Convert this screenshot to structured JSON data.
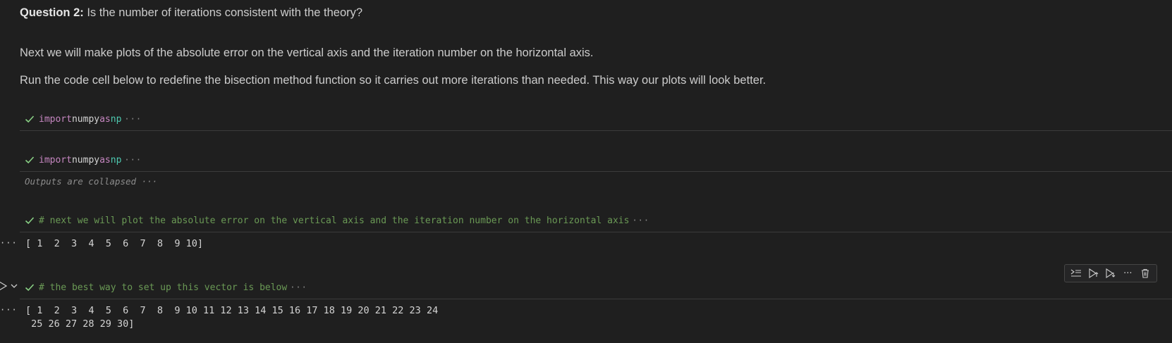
{
  "markdown": {
    "question_bold": "Question 2:",
    "question_text": " Is the number of iterations consistent with the theory?",
    "para1": "Next we will make plots of the absolute error on the vertical axis and the iteration number on the horizontal axis.",
    "para2": "Run the code cell below to redefine the bisection method function so it carries out more iterations than needed. This way our plots will look better."
  },
  "cells": [
    {
      "status": "success",
      "code_keyword": "import",
      "code_module": " numpy ",
      "code_as": "as",
      "code_alias": " np",
      "more": "···"
    },
    {
      "status": "success",
      "code_keyword": "import",
      "code_module": " numpy ",
      "code_as": "as",
      "code_alias": " np",
      "more": "···",
      "collapsed_label": "Outputs are collapsed ···"
    },
    {
      "status": "success",
      "comment": "# next we will plot the absolute error on the vertical axis and the iteration number on the horizontal axis",
      "more": "···",
      "output_ellipsis": "···",
      "output": "[ 1  2  3  4  5  6  7  8  9 10]"
    },
    {
      "status": "success",
      "comment": "# the best way to set up this vector is below",
      "more": "···",
      "output_ellipsis": "···",
      "output": "[ 1  2  3  4  5  6  7  8  9 10 11 12 13 14 15 16 17 18 19 20 21 22 23 24\n 25 26 27 28 29 30]"
    }
  ],
  "toolbar": {
    "icons": [
      "execute-above-icon",
      "run-above-icon",
      "run-below-icon",
      "more-actions-icon",
      "delete-icon"
    ],
    "more_label": "···"
  },
  "colors": {
    "background": "#1f1f1f",
    "keyword": "#c586c0",
    "alias": "#4ec9b0",
    "comment": "#6a9955",
    "check": "#89d185"
  }
}
